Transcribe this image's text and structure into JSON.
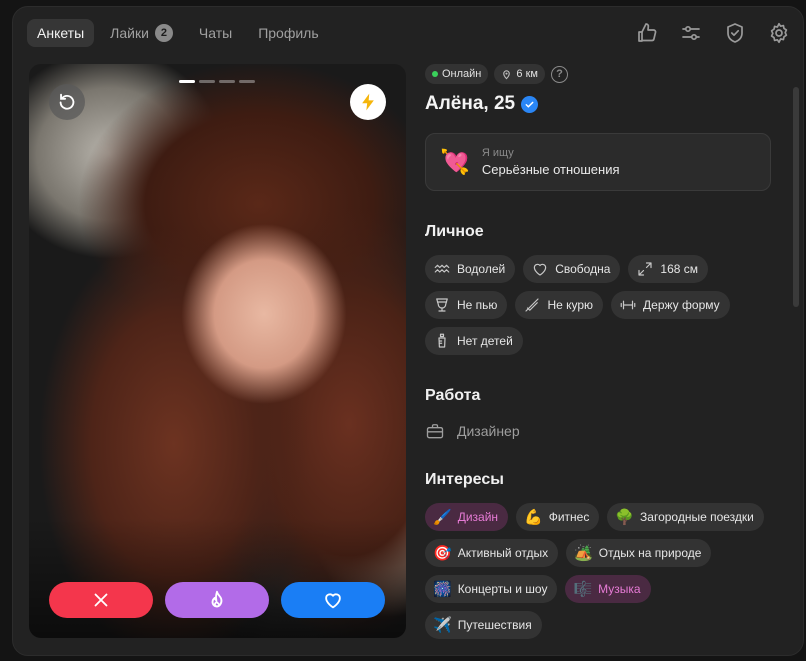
{
  "nav": {
    "tabs": [
      {
        "label": "Анкеты",
        "active": true
      },
      {
        "label": "Лайки",
        "badge": "2"
      },
      {
        "label": "Чаты"
      },
      {
        "label": "Профиль"
      }
    ],
    "icons": [
      "thumbs-up-icon",
      "sliders-icon",
      "shield-check-icon",
      "gear-icon"
    ]
  },
  "photo": {
    "pages_total": 4,
    "page_current": 1,
    "actions": [
      "close-icon",
      "flame-icon",
      "heart-icon"
    ]
  },
  "profile": {
    "status": "Онлайн",
    "distance": "6 км",
    "name": "Алёна, 25",
    "verified": true,
    "looking_for": {
      "label": "Я ищу",
      "value": "Серьёзные отношения"
    },
    "personal": {
      "title": "Личное",
      "items": [
        {
          "icon": "aquarius-icon",
          "label": "Водолей"
        },
        {
          "icon": "heart-outline-icon",
          "label": "Свободна"
        },
        {
          "icon": "height-icon",
          "label": "168 см"
        },
        {
          "icon": "glass-icon",
          "label": "Не пью"
        },
        {
          "icon": "no-smoking-icon",
          "label": "Не курю"
        },
        {
          "icon": "dumbbell-icon",
          "label": "Держу форму"
        },
        {
          "icon": "baby-bottle-icon",
          "label": "Нет детей"
        }
      ]
    },
    "work": {
      "title": "Работа",
      "value": "Дизайнер"
    },
    "interests": {
      "title": "Интересы",
      "items": [
        {
          "emoji": "🖌️",
          "label": "Дизайн",
          "highlight": true
        },
        {
          "emoji": "💪",
          "label": "Фитнес"
        },
        {
          "emoji": "🌳",
          "label": "Загородные поездки"
        },
        {
          "emoji": "🎯",
          "label": "Активный отдых"
        },
        {
          "emoji": "🏕️",
          "label": "Отдых на природе"
        },
        {
          "emoji": "🎆",
          "label": "Концерты и шоу"
        },
        {
          "emoji": "🎼",
          "label": "Музыка",
          "highlight": true
        },
        {
          "emoji": "✈️",
          "label": "Путешествия"
        }
      ]
    }
  },
  "colors": {
    "dislike": "#f4364c",
    "superlike": "#b26be8",
    "like": "#1a7ef5",
    "online": "#3ad15b",
    "highlight_text": "#e77bd6"
  }
}
